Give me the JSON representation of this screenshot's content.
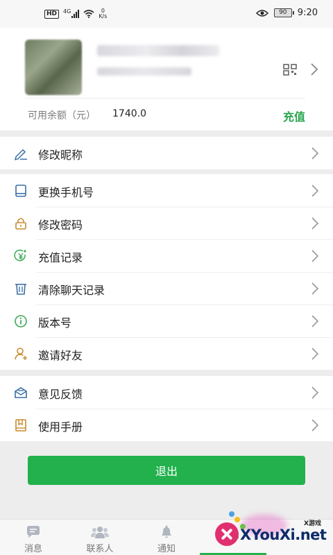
{
  "status_bar": {
    "hd": "HD",
    "network": "4G",
    "net_speed_value": "0",
    "net_speed_unit": "K/s",
    "battery": "90",
    "time": "9:20"
  },
  "profile": {
    "balance_label": "可用余额（元）",
    "balance_value": "1740.0",
    "recharge_label": "充值"
  },
  "menu_groups": [
    [
      {
        "name": "edit-nickname",
        "label": "修改昵称",
        "icon": "pen-icon"
      }
    ],
    [
      {
        "name": "change-phone",
        "label": "更换手机号",
        "icon": "phone-icon"
      },
      {
        "name": "change-password",
        "label": "修改密码",
        "icon": "lock-icon"
      },
      {
        "name": "recharge-records",
        "label": "充值记录",
        "icon": "yuan-icon"
      },
      {
        "name": "clear-chat",
        "label": "清除聊天记录",
        "icon": "trash-icon"
      },
      {
        "name": "version",
        "label": "版本号",
        "icon": "info-icon"
      },
      {
        "name": "invite-friends",
        "label": "邀请好友",
        "icon": "add-user-icon"
      }
    ],
    [
      {
        "name": "feedback",
        "label": "意见反馈",
        "icon": "mail-icon"
      },
      {
        "name": "user-manual",
        "label": "使用手册",
        "icon": "book-icon"
      }
    ]
  ],
  "logout_label": "退出",
  "tabs": [
    {
      "name": "messages",
      "label": "消息",
      "icon": "chat-bubble-icon"
    },
    {
      "name": "contacts",
      "label": "联系人",
      "icon": "contacts-icon"
    },
    {
      "name": "notifications",
      "label": "通知",
      "icon": "bell-icon"
    },
    {
      "name": "me",
      "label": "",
      "icon": "user-icon"
    }
  ],
  "colors": {
    "accent": "#22b14c",
    "recharge": "#2aa44f",
    "icon_blue": "#3a6ea5",
    "icon_orange": "#c98a2f",
    "icon_green": "#3aa856"
  },
  "watermark": {
    "site": "XYouXi.net",
    "tag": "X游戏"
  }
}
